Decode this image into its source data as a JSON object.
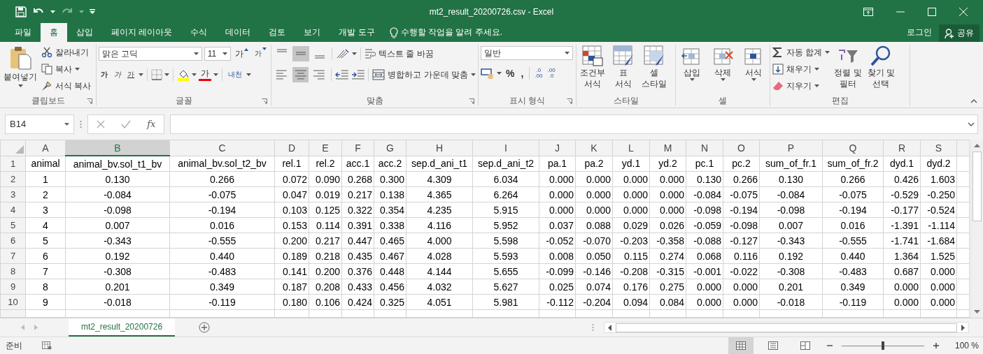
{
  "title_bar": {
    "title": "mt2_result_20200726.csv - Excel",
    "redo_disabled": true
  },
  "tabs": [
    {
      "label": "파일",
      "selected": false
    },
    {
      "label": "홈",
      "selected": true
    },
    {
      "label": "삽입",
      "selected": false
    },
    {
      "label": "페이지 레이아웃",
      "selected": false
    },
    {
      "label": "수식",
      "selected": false
    },
    {
      "label": "데이터",
      "selected": false
    },
    {
      "label": "검토",
      "selected": false
    },
    {
      "label": "보기",
      "selected": false
    },
    {
      "label": "개발 도구",
      "selected": false
    }
  ],
  "tell_me": "수행할 작업을 알려 주세요.",
  "login": "로그인",
  "share": "공유",
  "clipboard": {
    "paste": "붙여넣기",
    "cut": "잘라내기",
    "copy": "복사",
    "format_painter": "서식 복사",
    "label": "클립보드"
  },
  "font": {
    "name": "맑은 고딕",
    "size": "11",
    "grow": "가",
    "shrink": "가",
    "bold": "가",
    "italic": "가",
    "underline": "가",
    "font_color": "가",
    "phonetic": "내천",
    "label": "글꼴"
  },
  "alignment": {
    "buttons": [
      {
        "selected": false
      },
      {
        "selected": true
      },
      {
        "selected": false
      },
      {
        "selected": false
      },
      {
        "selected": true
      },
      {
        "selected": false
      }
    ],
    "wrap": "텍스트 줄 바꿈",
    "merge": "병합하고 가운데 맞춤",
    "label": "맞춤"
  },
  "number": {
    "format": "일반",
    "percent": "%",
    "comma": ",",
    "decimals": [
      {
        "top": ".0",
        "bottom": ".00"
      },
      {
        "top": ".00",
        "bottom": ".0"
      }
    ],
    "label": "표시 형식"
  },
  "styles": {
    "items": [
      {
        "lines": [
          "조건부",
          "서식"
        ]
      },
      {
        "lines": [
          "표",
          "서식"
        ]
      },
      {
        "lines": [
          "셀",
          "스타일"
        ]
      }
    ],
    "label": "스타일"
  },
  "cells": {
    "items": [
      "삽입",
      "삭제",
      "서식"
    ],
    "label": "셀"
  },
  "editing": {
    "autosum": "자동 합계",
    "fill": "채우기",
    "clear": "지우기",
    "sort": [
      "정렬 및",
      "필터"
    ],
    "find": [
      "찾기 및",
      "선택"
    ],
    "label": "편집"
  },
  "formula_bar": {
    "name_box": "B14",
    "fx": "fx"
  },
  "columns": [
    {
      "letter": "A",
      "selected": false
    },
    {
      "letter": "B",
      "selected": true
    },
    {
      "letter": "C",
      "selected": false
    },
    {
      "letter": "D",
      "selected": false
    },
    {
      "letter": "E",
      "selected": false
    },
    {
      "letter": "F",
      "selected": false
    },
    {
      "letter": "G",
      "selected": false
    },
    {
      "letter": "H",
      "selected": false
    },
    {
      "letter": "I",
      "selected": false
    },
    {
      "letter": "J",
      "selected": false
    },
    {
      "letter": "K",
      "selected": false
    },
    {
      "letter": "L",
      "selected": false
    },
    {
      "letter": "M",
      "selected": false
    },
    {
      "letter": "N",
      "selected": false
    },
    {
      "letter": "O",
      "selected": false
    },
    {
      "letter": "P",
      "selected": false
    },
    {
      "letter": "Q",
      "selected": false
    },
    {
      "letter": "R",
      "selected": false
    },
    {
      "letter": "S",
      "selected": false
    }
  ],
  "rows": [
    {
      "number": "1",
      "cells": [
        "animal",
        "animal_bv.sol_t1_bv",
        "animal_bv.sol_t2_bv",
        "rel.1",
        "rel.2",
        "acc.1",
        "acc.2",
        "sep.d_ani_t1",
        "sep.d_ani_t2",
        "pa.1",
        "pa.2",
        "yd.1",
        "yd.2",
        "pc.1",
        "pc.2",
        "sum_of_fr.1",
        "sum_of_fr.2",
        "dyd.1",
        "dyd.2"
      ]
    },
    {
      "number": "2",
      "cells": [
        "1",
        "0.130",
        "0.266",
        "0.072",
        "0.090",
        "0.268",
        "0.300",
        "4.309",
        "6.034",
        "0.000",
        "0.000",
        "0.000",
        "0.000",
        "0.130",
        "0.266",
        "0.130",
        "0.266",
        "0.426",
        "1.603"
      ]
    },
    {
      "number": "3",
      "cells": [
        "2",
        "-0.084",
        "-0.075",
        "0.047",
        "0.019",
        "0.217",
        "0.138",
        "4.365",
        "6.264",
        "0.000",
        "0.000",
        "0.000",
        "0.000",
        "-0.084",
        "-0.075",
        "-0.084",
        "-0.075",
        "-0.529",
        "-0.250"
      ]
    },
    {
      "number": "4",
      "cells": [
        "3",
        "-0.098",
        "-0.194",
        "0.103",
        "0.125",
        "0.322",
        "0.354",
        "4.235",
        "5.915",
        "0.000",
        "0.000",
        "0.000",
        "0.000",
        "-0.098",
        "-0.194",
        "-0.098",
        "-0.194",
        "-0.177",
        "-0.524"
      ]
    },
    {
      "number": "5",
      "cells": [
        "4",
        "0.007",
        "0.016",
        "0.153",
        "0.114",
        "0.391",
        "0.338",
        "4.116",
        "5.952",
        "0.037",
        "0.088",
        "0.029",
        "0.026",
        "-0.059",
        "-0.098",
        "0.007",
        "0.016",
        "-1.391",
        "-1.114"
      ]
    },
    {
      "number": "6",
      "cells": [
        "5",
        "-0.343",
        "-0.555",
        "0.200",
        "0.217",
        "0.447",
        "0.465",
        "4.000",
        "5.598",
        "-0.052",
        "-0.070",
        "-0.203",
        "-0.358",
        "-0.088",
        "-0.127",
        "-0.343",
        "-0.555",
        "-1.741",
        "-1.684"
      ]
    },
    {
      "number": "7",
      "cells": [
        "6",
        "0.192",
        "0.440",
        "0.189",
        "0.218",
        "0.435",
        "0.467",
        "4.028",
        "5.593",
        "0.008",
        "0.050",
        "0.115",
        "0.274",
        "0.068",
        "0.116",
        "0.192",
        "0.440",
        "1.364",
        "1.525"
      ]
    },
    {
      "number": "8",
      "cells": [
        "7",
        "-0.308",
        "-0.483",
        "0.141",
        "0.200",
        "0.376",
        "0.448",
        "4.144",
        "5.655",
        "-0.099",
        "-0.146",
        "-0.208",
        "-0.315",
        "-0.001",
        "-0.022",
        "-0.308",
        "-0.483",
        "0.687",
        "0.000"
      ]
    },
    {
      "number": "9",
      "cells": [
        "8",
        "0.201",
        "0.349",
        "0.187",
        "0.208",
        "0.433",
        "0.456",
        "4.032",
        "5.627",
        "0.025",
        "0.074",
        "0.176",
        "0.275",
        "0.000",
        "0.000",
        "0.201",
        "0.349",
        "0.000",
        "0.000"
      ]
    },
    {
      "number": "10",
      "cells": [
        "9",
        "-0.018",
        "-0.119",
        "0.180",
        "0.106",
        "0.424",
        "0.325",
        "4.051",
        "5.981",
        "-0.112",
        "-0.204",
        "0.094",
        "0.084",
        "0.000",
        "0.000",
        "-0.018",
        "-0.119",
        "0.000",
        "0.000"
      ]
    }
  ],
  "sheet_tabs": [
    {
      "label": "mt2_result_20200726",
      "selected": true
    }
  ],
  "status_bar": {
    "status": "준비",
    "views": [
      {
        "selected": true
      },
      {
        "selected": false
      },
      {
        "selected": false
      }
    ],
    "zoom": {
      "level": 0.5,
      "reading": "100 %"
    }
  }
}
